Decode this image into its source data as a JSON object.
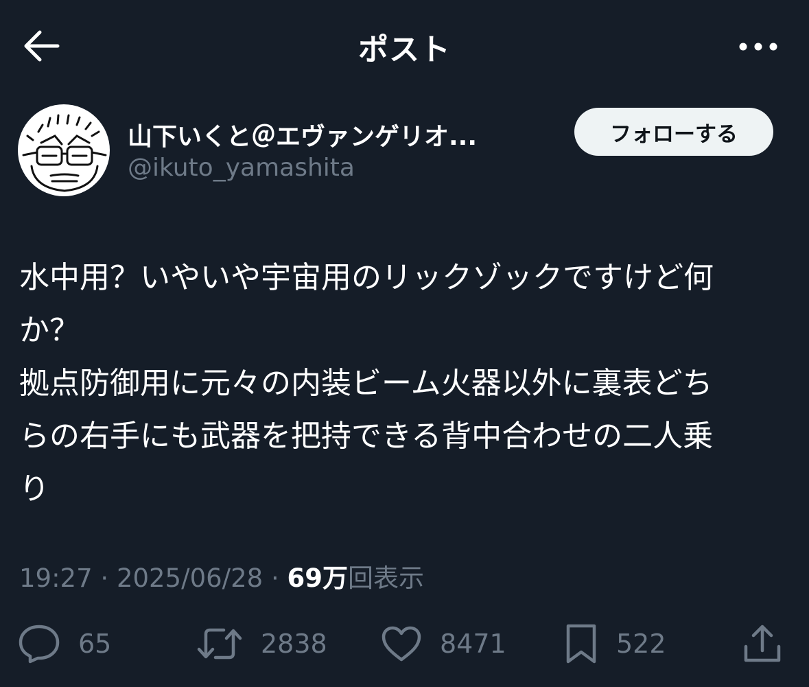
{
  "header": {
    "title": "ポスト"
  },
  "author": {
    "display_name": "山下いくと＠エヴァンゲリオ...",
    "handle": "@ikuto_yamashita",
    "follow_label": "フォローする"
  },
  "post": {
    "text": "水中用？いやいや宇宙用のリックゾックですけど何\nか？\n拠点防御用に元々の内装ビーム火器以外に裏表どち\nらの右手にも武器を把持できる背中合わせの二人乗\nり",
    "time": "19:27",
    "separator": "·",
    "date": "2025/06/28",
    "views_count": "69万",
    "views_label": "回表示"
  },
  "actions": {
    "replies": "65",
    "reposts": "2838",
    "likes": "8471",
    "bookmarks": "522"
  },
  "colors": {
    "background": "#151d28",
    "text": "#ffffff",
    "muted": "#6e7a88",
    "follow_bg": "#eef3f4"
  }
}
